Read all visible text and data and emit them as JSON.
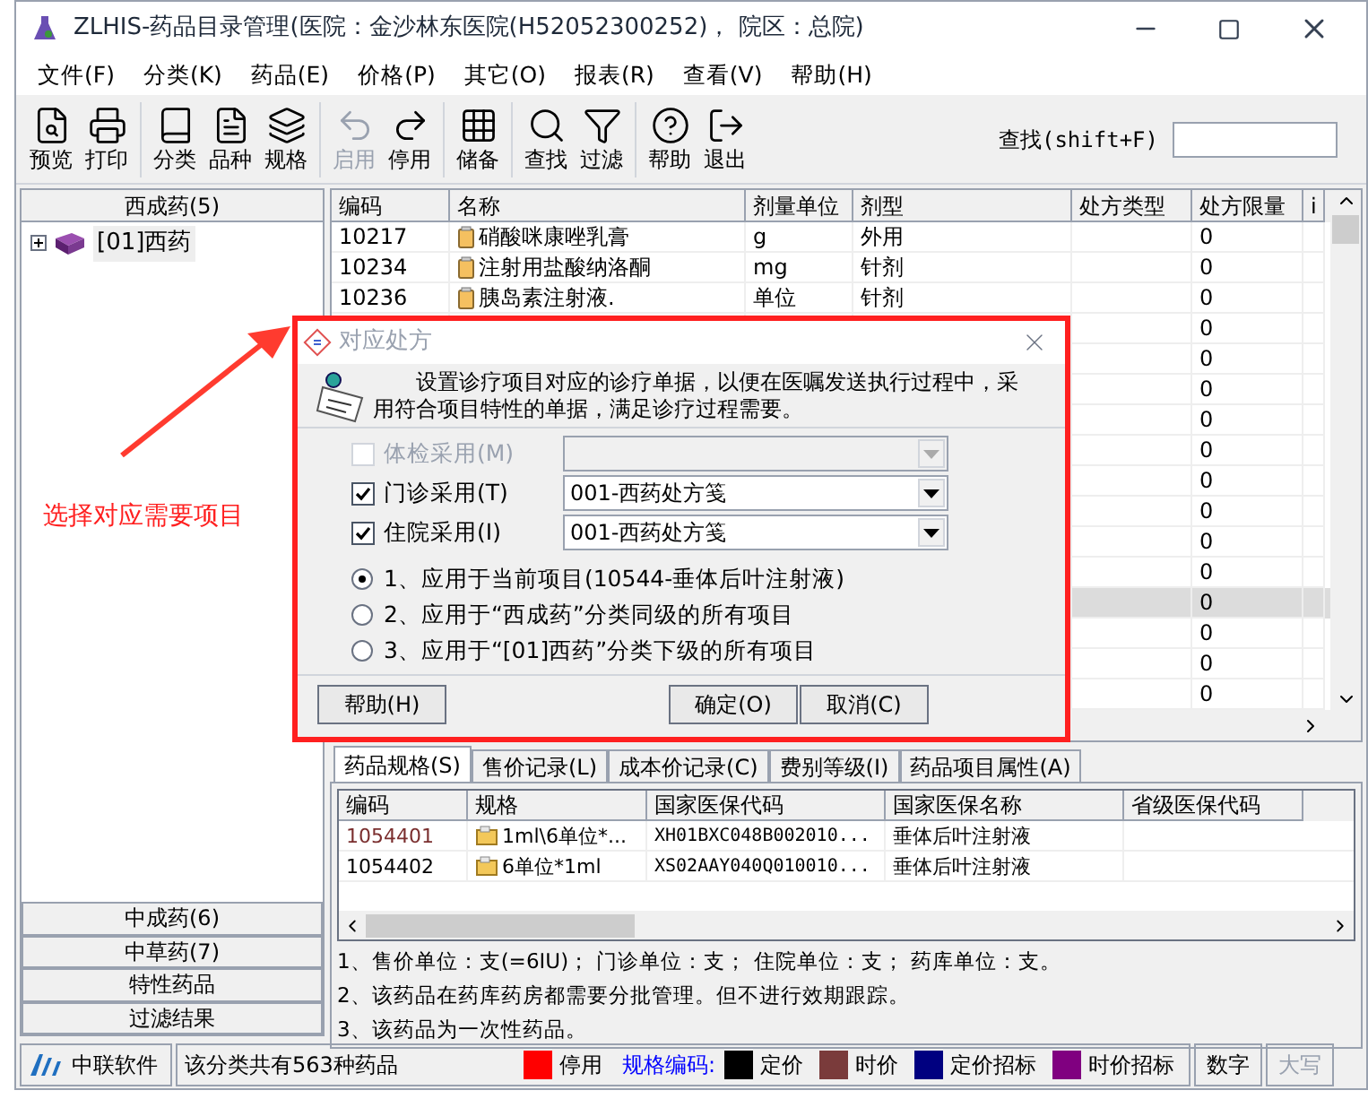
{
  "window": {
    "title": "ZLHIS-药品目录管理(医院：金沙林东医院(H52052300252)， 院区：总院)"
  },
  "menu": [
    "文件(F)",
    "分类(K)",
    "药品(E)",
    "价格(P)",
    "其它(O)",
    "报表(R)",
    "查看(V)",
    "帮助(H)"
  ],
  "toolbar": [
    {
      "kind": "preview",
      "label": "预览",
      "disabled": false
    },
    {
      "kind": "print",
      "label": "打印",
      "disabled": false
    },
    {
      "kind": "sep"
    },
    {
      "kind": "category",
      "label": "分类",
      "disabled": false
    },
    {
      "kind": "variety",
      "label": "品种",
      "disabled": false
    },
    {
      "kind": "spec",
      "label": "规格",
      "disabled": false
    },
    {
      "kind": "sep"
    },
    {
      "kind": "enable",
      "label": "启用",
      "disabled": true
    },
    {
      "kind": "disable",
      "label": "停用",
      "disabled": false
    },
    {
      "kind": "sep"
    },
    {
      "kind": "storage",
      "label": "储备",
      "disabled": false
    },
    {
      "kind": "sep"
    },
    {
      "kind": "find",
      "label": "查找",
      "disabled": false
    },
    {
      "kind": "filter",
      "label": "过滤",
      "disabled": false
    },
    {
      "kind": "sep"
    },
    {
      "kind": "help",
      "label": "帮助",
      "disabled": false
    },
    {
      "kind": "exit",
      "label": "退出",
      "disabled": false
    }
  ],
  "search": {
    "label": "查找(shift+F)"
  },
  "sidebar": {
    "header": "西成药(5)",
    "tree": [
      {
        "label": "[01]西药",
        "expanded": false
      }
    ],
    "groups": [
      "中成药(6)",
      "中草药(7)",
      "特性药品",
      "过滤结果"
    ]
  },
  "table": {
    "columns": [
      "编码",
      "名称",
      "剂量单位",
      "剂型",
      "处方类型",
      "处方限量",
      "i"
    ],
    "rows": [
      {
        "code": "10217",
        "name": "硝酸咪康唑乳膏",
        "unit": "g",
        "form": "外用",
        "limit": "0",
        "selected": false
      },
      {
        "code": "10234",
        "name": "注射用盐酸纳洛酮",
        "unit": "mg",
        "form": "针剂",
        "limit": "0",
        "selected": false
      },
      {
        "code": "10236",
        "name": "胰岛素注射液.",
        "unit": "单位",
        "form": "针剂",
        "limit": "0",
        "selected": false
      },
      {
        "limit": "0",
        "selected": false
      },
      {
        "limit": "0",
        "selected": false
      },
      {
        "limit": "0",
        "selected": false
      },
      {
        "limit": "0",
        "selected": false
      },
      {
        "limit": "0",
        "selected": false
      },
      {
        "limit": "0",
        "selected": false
      },
      {
        "limit": "0",
        "selected": false
      },
      {
        "limit": "0",
        "selected": false
      },
      {
        "limit": "0",
        "selected": false
      },
      {
        "limit": "0",
        "selected": true
      },
      {
        "limit": "0",
        "selected": false
      },
      {
        "limit": "0",
        "selected": false
      },
      {
        "limit": "0",
        "selected": false
      }
    ]
  },
  "tabs": [
    {
      "label": "药品规格(S)",
      "selected": true
    },
    {
      "label": "售价记录(L)",
      "selected": false
    },
    {
      "label": "成本价记录(C)",
      "selected": false
    },
    {
      "label": "费别等级(I)",
      "selected": false
    },
    {
      "label": "药品项目属性(A)",
      "selected": false
    }
  ],
  "spec_table": {
    "columns": [
      "编码",
      "规格",
      "国家医保代码",
      "国家医保名称",
      "省级医保代码"
    ],
    "rows": [
      {
        "code": "1054401",
        "spec": "1ml\\6单位*...",
        "national_code": "XH01BXC048B002010...",
        "national_name": "垂体后叶注射液",
        "color": "#7a2e2e"
      },
      {
        "code": "1054402",
        "spec": "6单位*1ml",
        "national_code": "XS02AAY040Q010010...",
        "national_name": "垂体后叶注射液",
        "color": "#000000"
      }
    ]
  },
  "notes": [
    "1、售价单位：支(=6IU)； 门诊单位：支； 住院单位：支； 药库单位：支。",
    "2、该药品在药库药房都需要分批管理。但不进行效期跟踪。",
    "3、该药品为一次性药品。"
  ],
  "status_bar": {
    "company": "中联软件",
    "count": "该分类共有563种药品",
    "legend": [
      {
        "label": "停用",
        "color": "#ff0000"
      }
    ],
    "spec_label": "规格编码:",
    "spec_legend": [
      {
        "label": "定价",
        "color": "#000000"
      },
      {
        "label": "时价",
        "color": "#7a3b3b"
      },
      {
        "label": "定价招标",
        "color": "#000080"
      },
      {
        "label": "时价招标",
        "color": "#800080"
      }
    ],
    "keys": [
      {
        "label": "数字",
        "disabled": false
      },
      {
        "label": "大写",
        "disabled": true
      }
    ]
  },
  "dialog": {
    "title": "对应处方",
    "description": "设置诊疗项目对应的诊疗单据，以便在医嘱发送执行过程中，采用符合项目特性的单据，满足诊疗过程需要。",
    "options": [
      {
        "label": "体检采用(M)",
        "checked": false,
        "disabled": true
      },
      {
        "label": "门诊采用(T)",
        "checked": true,
        "disabled": false,
        "value": "001-西药处方笺"
      },
      {
        "label": "住院采用(I)",
        "checked": true,
        "disabled": false,
        "value": "001-西药处方笺"
      }
    ],
    "scopes": [
      {
        "label": "1、应用于当前项目(10544-垂体后叶注射液)",
        "selected": true
      },
      {
        "label": "2、应用于“西成药”分类同级的所有项目",
        "selected": false
      },
      {
        "label": "3、应用于“[01]西药”分类下级的所有项目",
        "selected": false
      }
    ],
    "buttons": [
      "帮助(H)",
      "确定(O)",
      "取消(C)"
    ]
  },
  "annotation": {
    "text": "选择对应需要项目"
  }
}
